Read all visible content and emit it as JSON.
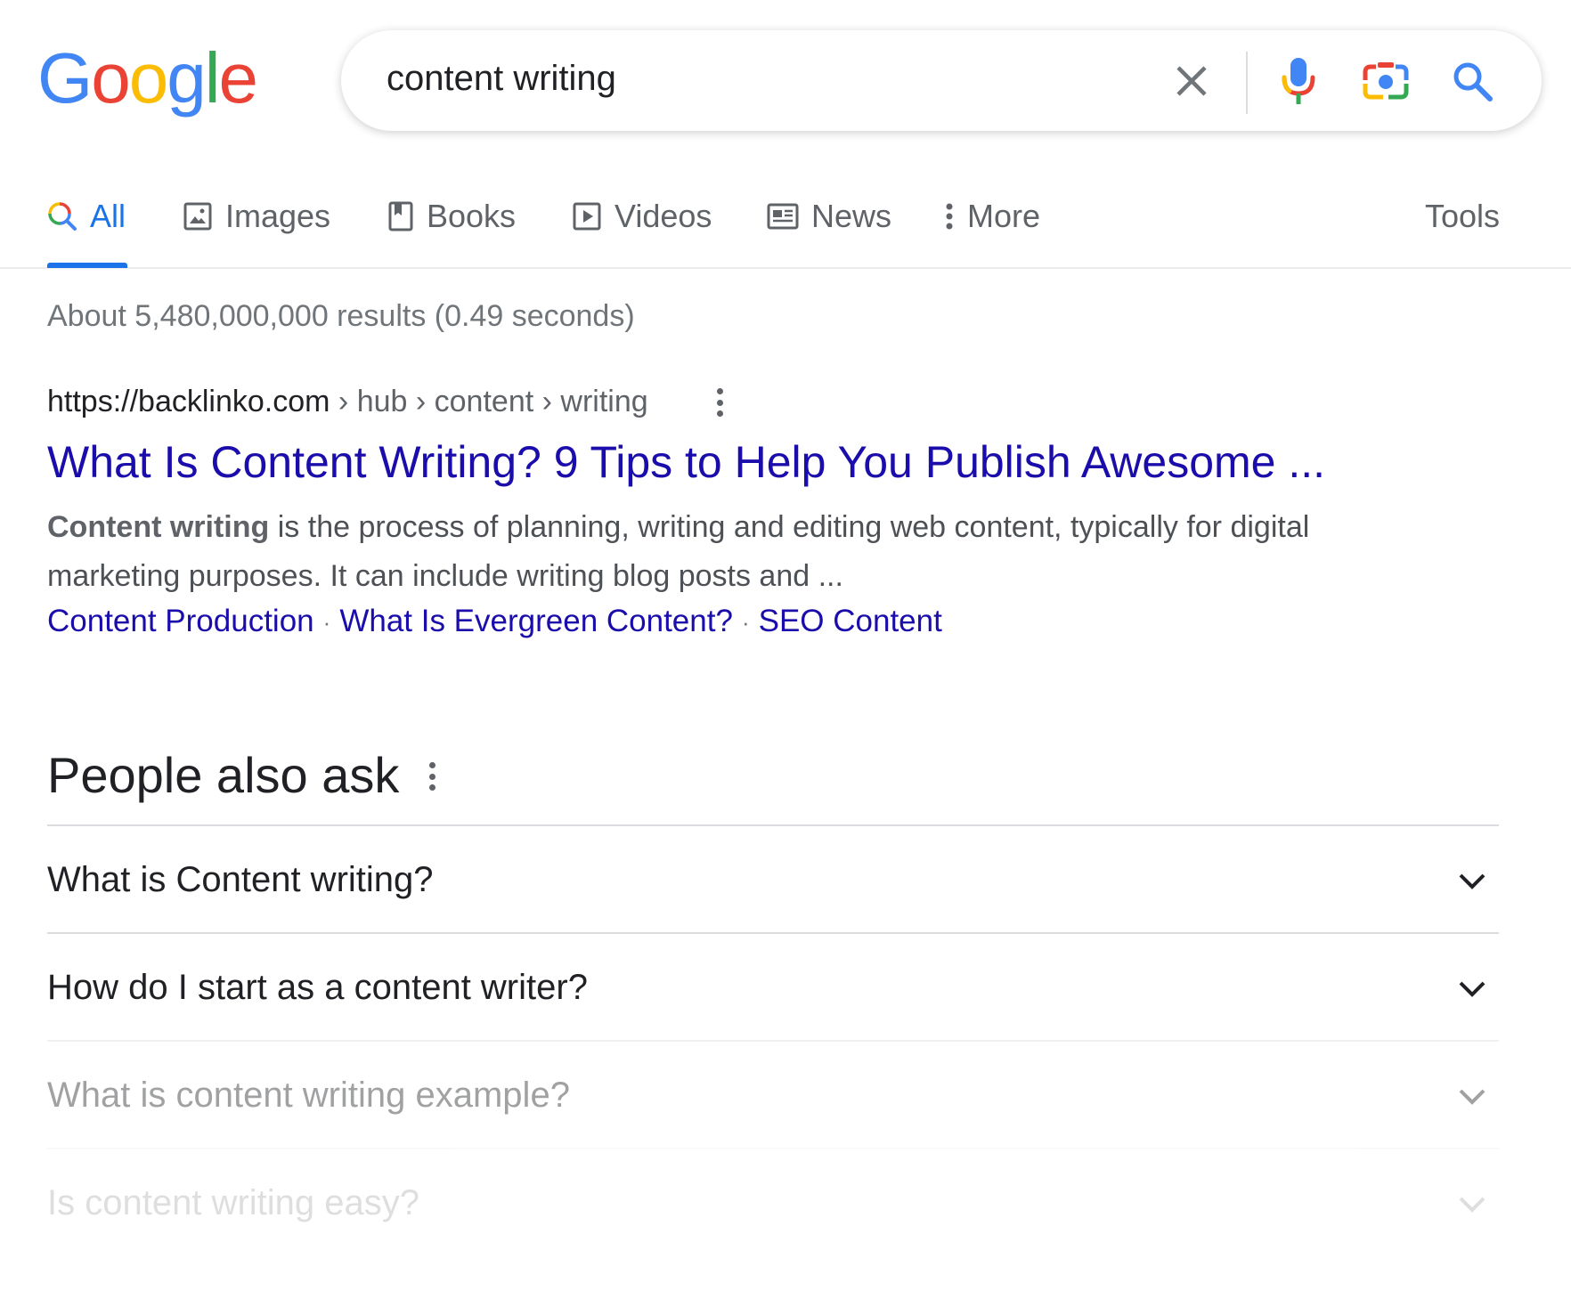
{
  "logo": {
    "letters": [
      "G",
      "o",
      "o",
      "g",
      "l",
      "e"
    ],
    "colors": [
      "#4285F4",
      "#EA4335",
      "#FBBC05",
      "#4285F4",
      "#34A853",
      "#EA4335"
    ]
  },
  "search": {
    "query": "content writing",
    "icons": [
      "close-icon",
      "microphone-icon",
      "camera-icon",
      "search-icon"
    ]
  },
  "tabs": [
    {
      "label": "All",
      "icon": "search-icon",
      "active": true
    },
    {
      "label": "Images",
      "icon": "image-icon"
    },
    {
      "label": "Books",
      "icon": "book-icon"
    },
    {
      "label": "Videos",
      "icon": "video-icon"
    },
    {
      "label": "News",
      "icon": "news-icon"
    },
    {
      "label": "More",
      "icon": "more-vert-icon"
    }
  ],
  "tools_label": "Tools",
  "stats": "About 5,480,000,000 results (0.49 seconds)",
  "result": {
    "url": "https://backlinko.com",
    "path": " › hub › content › writing",
    "title": "What Is Content Writing? 9 Tips to Help You Publish Awesome ...",
    "snippet_bold": "Content writing",
    "snippet_rest": " is the process of planning, writing and editing web content, typically for digital marketing purposes. It can include writing blog posts and ...",
    "sitelinks": [
      "Content Production",
      "What Is Evergreen Content?",
      "SEO Content"
    ],
    "sitelink_separator": "·"
  },
  "people_also_ask": {
    "title": "People also ask",
    "questions": [
      "What is Content writing?",
      "How do I start as a content writer?",
      "What is content writing example?",
      "Is content writing easy?"
    ]
  },
  "colors": {
    "link": "#1a0dab",
    "accent": "#1a73e8",
    "muted": "#70757a"
  }
}
